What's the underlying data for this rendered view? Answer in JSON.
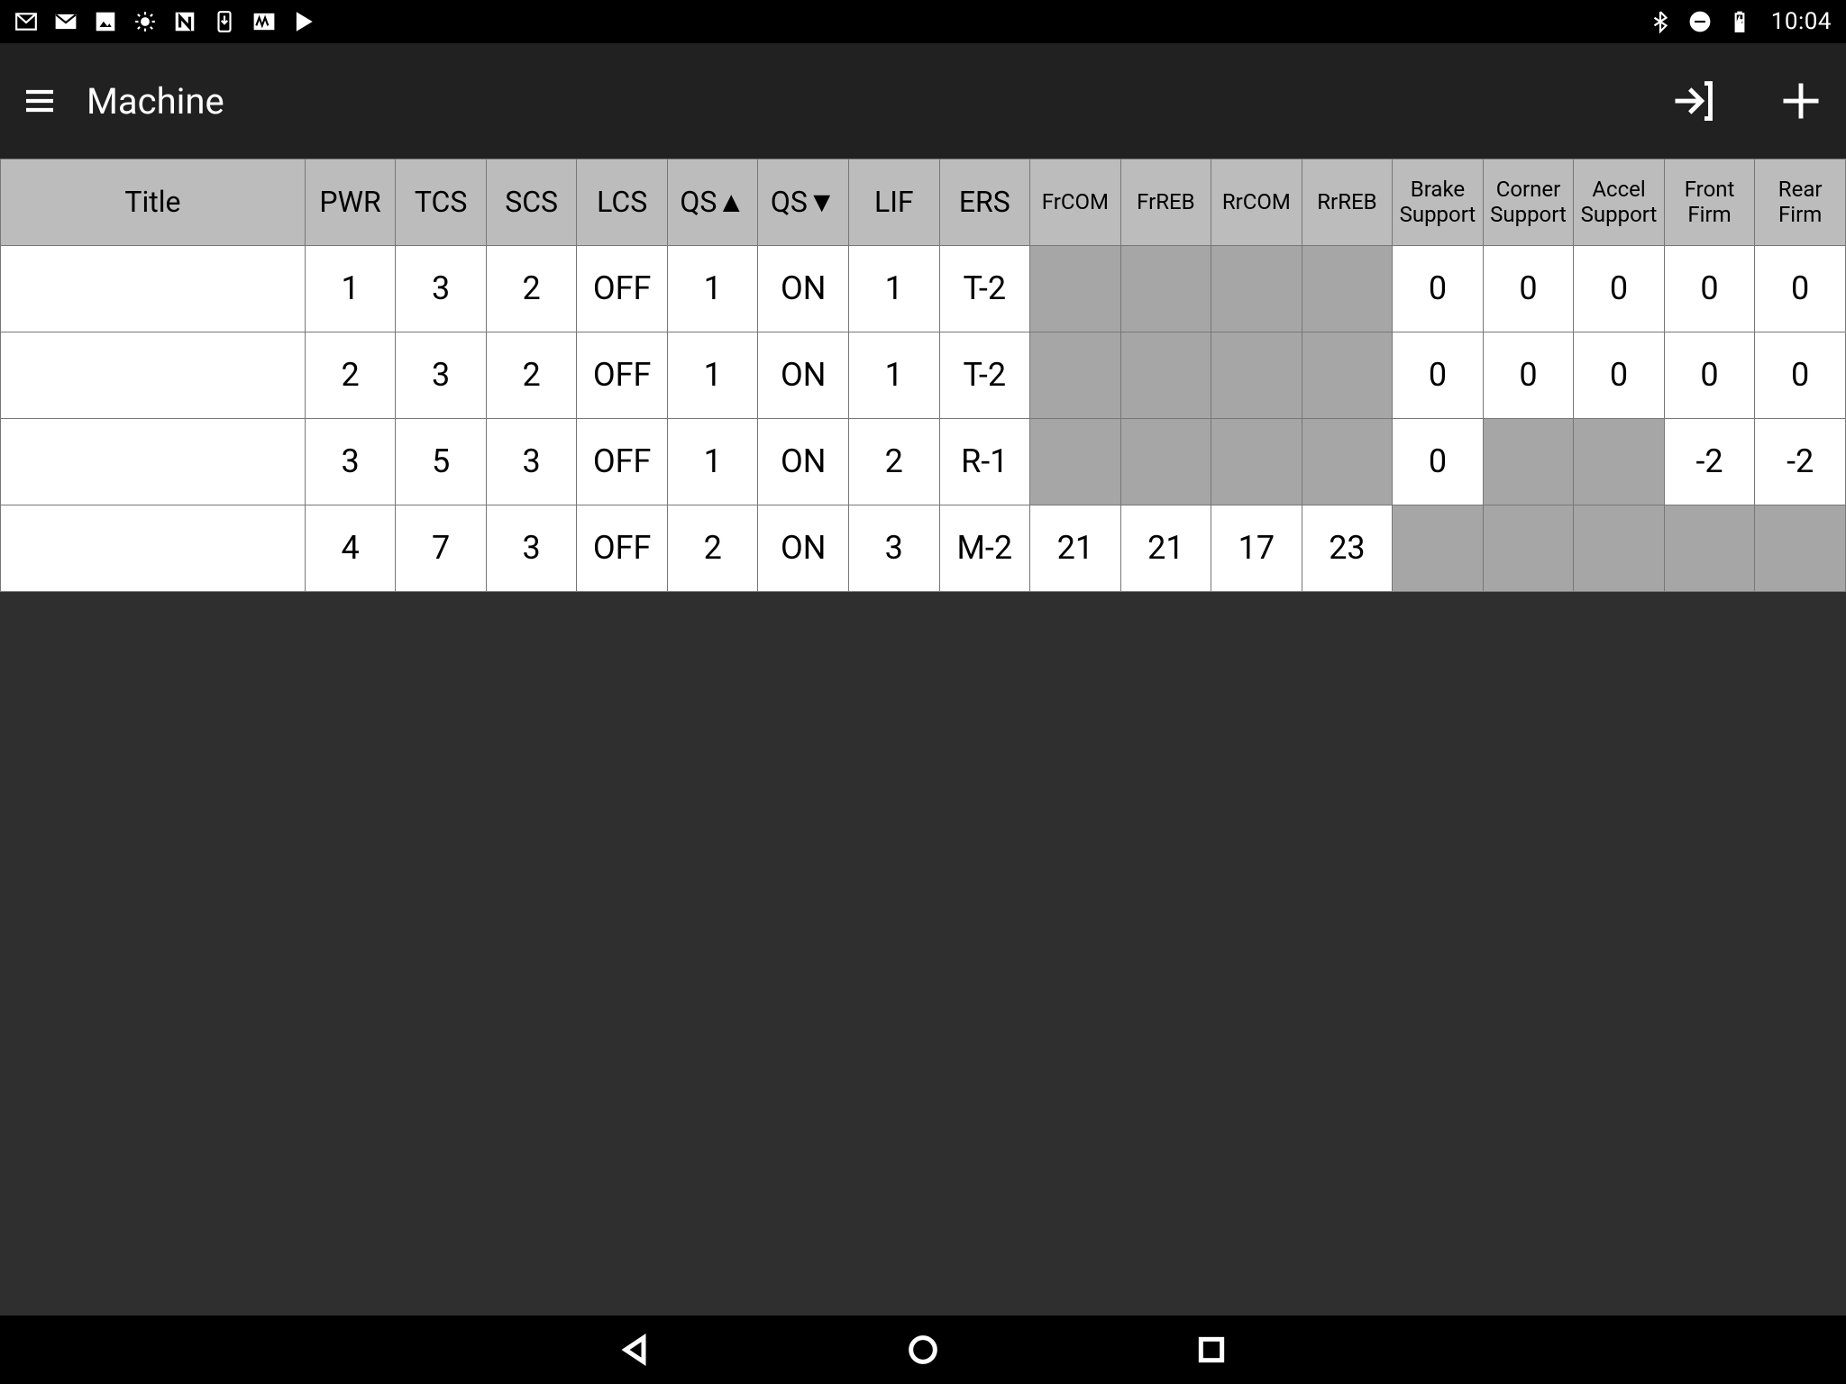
{
  "status_bar": {
    "time": "10:04"
  },
  "app_bar": {
    "title": "Machine"
  },
  "table": {
    "headers": [
      "Title",
      "PWR",
      "TCS",
      "SCS",
      "LCS",
      "QS▲",
      "QS▼",
      "LIF",
      "ERS",
      "FrCOM",
      "FrREB",
      "RrCOM",
      "RrREB",
      "Brake Support",
      "Corner Support",
      "Accel Support",
      "Front Firm",
      "Rear Firm"
    ],
    "rows": [
      {
        "cells": [
          {
            "v": ""
          },
          {
            "v": "1"
          },
          {
            "v": "3"
          },
          {
            "v": "2"
          },
          {
            "v": "OFF"
          },
          {
            "v": "1"
          },
          {
            "v": "ON"
          },
          {
            "v": "1"
          },
          {
            "v": "T-2"
          },
          {
            "v": "",
            "disabled": true
          },
          {
            "v": "",
            "disabled": true
          },
          {
            "v": "",
            "disabled": true
          },
          {
            "v": "",
            "disabled": true
          },
          {
            "v": "0"
          },
          {
            "v": "0"
          },
          {
            "v": "0"
          },
          {
            "v": "0"
          },
          {
            "v": "0"
          }
        ]
      },
      {
        "cells": [
          {
            "v": ""
          },
          {
            "v": "2"
          },
          {
            "v": "3"
          },
          {
            "v": "2"
          },
          {
            "v": "OFF"
          },
          {
            "v": "1"
          },
          {
            "v": "ON"
          },
          {
            "v": "1"
          },
          {
            "v": "T-2"
          },
          {
            "v": "",
            "disabled": true
          },
          {
            "v": "",
            "disabled": true
          },
          {
            "v": "",
            "disabled": true
          },
          {
            "v": "",
            "disabled": true
          },
          {
            "v": "0"
          },
          {
            "v": "0"
          },
          {
            "v": "0"
          },
          {
            "v": "0"
          },
          {
            "v": "0"
          }
        ]
      },
      {
        "cells": [
          {
            "v": ""
          },
          {
            "v": "3"
          },
          {
            "v": "5"
          },
          {
            "v": "3"
          },
          {
            "v": "OFF"
          },
          {
            "v": "1"
          },
          {
            "v": "ON"
          },
          {
            "v": "2"
          },
          {
            "v": "R-1"
          },
          {
            "v": "",
            "disabled": true
          },
          {
            "v": "",
            "disabled": true
          },
          {
            "v": "",
            "disabled": true
          },
          {
            "v": "",
            "disabled": true
          },
          {
            "v": "0"
          },
          {
            "v": "",
            "disabled": true
          },
          {
            "v": "",
            "disabled": true
          },
          {
            "v": "-2"
          },
          {
            "v": "-2"
          }
        ]
      },
      {
        "cells": [
          {
            "v": ""
          },
          {
            "v": "4"
          },
          {
            "v": "7"
          },
          {
            "v": "3"
          },
          {
            "v": "OFF"
          },
          {
            "v": "2"
          },
          {
            "v": "ON"
          },
          {
            "v": "3"
          },
          {
            "v": "M-2"
          },
          {
            "v": "21"
          },
          {
            "v": "21"
          },
          {
            "v": "17"
          },
          {
            "v": "23"
          },
          {
            "v": "",
            "disabled": true
          },
          {
            "v": "",
            "disabled": true
          },
          {
            "v": "",
            "disabled": true
          },
          {
            "v": "",
            "disabled": true
          },
          {
            "v": "",
            "disabled": true
          }
        ]
      }
    ]
  }
}
